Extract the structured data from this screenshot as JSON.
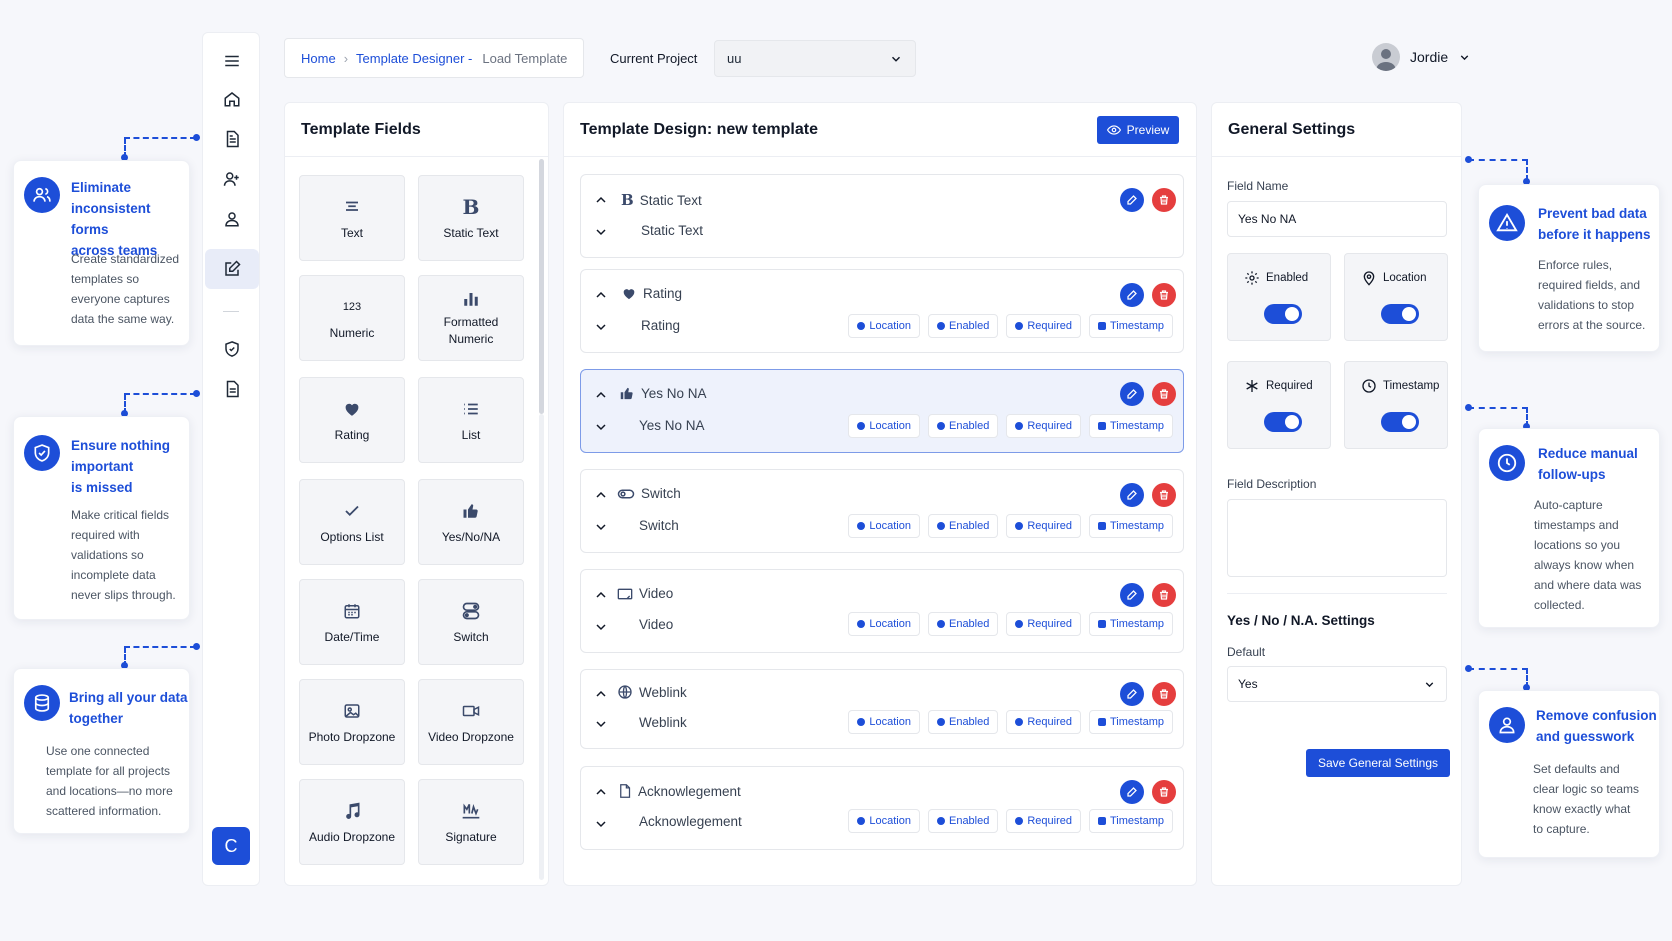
{
  "breadcrumb": {
    "home": "Home",
    "designer": "Template Designer -",
    "current": "Load Template"
  },
  "project": {
    "label": "Current Project",
    "value": "uu"
  },
  "user": {
    "name": "Jordie"
  },
  "sidebar": {
    "logo_letter": "C"
  },
  "callouts": [
    {
      "title1": "Eliminate",
      "title2": "inconsistent forms",
      "title3": "across teams",
      "lines": [
        "Create standardized",
        "templates so",
        "everyone captures",
        "data the same way."
      ]
    },
    {
      "title1": "Ensure nothing",
      "title2": "important",
      "title3": "is missed",
      "lines": [
        "Make critical fields",
        "required with",
        "validations so",
        "incomplete data",
        "never slips through."
      ]
    },
    {
      "title1": "Bring all your data",
      "title2": "together",
      "lines": [
        "Use one connected",
        "template for all projects",
        "and locations—no more",
        "scattered information."
      ]
    },
    {
      "title1": "Prevent bad data",
      "title2": "before it happens",
      "lines": [
        "Enforce rules,",
        "required fields, and",
        "validations to stop",
        "errors at the source."
      ]
    },
    {
      "title1": "Reduce manual",
      "title2": "follow-ups",
      "lines": [
        "Auto-capture",
        "timestamps and",
        "locations so you",
        "always know when",
        "and where data was",
        "collected."
      ]
    },
    {
      "title1": "Remove confusion",
      "title2": "and guesswork",
      "lines": [
        "Set defaults and",
        "clear logic so teams",
        "know exactly what",
        "to capture."
      ]
    }
  ],
  "template_fields": {
    "title": "Template Fields",
    "tiles": [
      {
        "label": "Text",
        "icon": "align-center-icon"
      },
      {
        "label": "Static Text",
        "icon": "bold-b-icon"
      },
      {
        "label": "Numeric",
        "icon": "123-icon",
        "glyph": "123"
      },
      {
        "label1": "Formatted",
        "label2": "Numeric",
        "icon": "bar-chart-icon"
      },
      {
        "label": "Rating",
        "icon": "heart-icon"
      },
      {
        "label": "List",
        "icon": "list-icon"
      },
      {
        "label": "Options List",
        "icon": "check-icon"
      },
      {
        "label": "Yes/No/NA",
        "icon": "thumbs-up-icon"
      },
      {
        "label": "Date/Time",
        "icon": "calendar-icon"
      },
      {
        "label": "Switch",
        "icon": "switch-icon"
      },
      {
        "label": "Photo Dropzone",
        "icon": "image-icon"
      },
      {
        "label": "Video Dropzone",
        "icon": "video-icon"
      },
      {
        "label": "Audio Dropzone",
        "icon": "music-icon"
      },
      {
        "label": "Signature",
        "icon": "signature-icon"
      }
    ]
  },
  "design": {
    "title": "Template Design: new template",
    "preview_label": "Preview",
    "tag_labels": {
      "location": "Location",
      "enabled": "Enabled",
      "required": "Required",
      "timestamp": "Timestamp"
    },
    "cards": [
      {
        "type": "Static Text",
        "name": "Static Text",
        "icon": "bold-b-icon"
      },
      {
        "type": "Rating",
        "name": "Rating",
        "icon": "heart-icon"
      },
      {
        "type": "Yes No NA",
        "name": "Yes No NA",
        "icon": "thumbs-up-icon"
      },
      {
        "type": "Switch",
        "name": "Switch",
        "icon": "switch-icon"
      },
      {
        "type": "Video",
        "name": "Video",
        "icon": "video-icon"
      },
      {
        "type": "Weblink",
        "name": "Weblink",
        "icon": "globe-icon"
      },
      {
        "type": "Acknowlegement",
        "name": "Acknowlegement",
        "icon": "file-icon"
      }
    ]
  },
  "settings": {
    "title": "General Settings",
    "field_name_label": "Field Name",
    "field_name_value": "Yes No NA",
    "toggles": [
      {
        "label": "Enabled",
        "on": true
      },
      {
        "label": "Location",
        "on": true
      },
      {
        "label": "Required",
        "on": true
      },
      {
        "label": "Timestamp",
        "on": true
      }
    ],
    "description_label": "Field Description",
    "description_value": "",
    "section_title": "Yes / No / N.A. Settings",
    "default_label": "Default",
    "default_value": "Yes",
    "save_label": "Save General Settings"
  },
  "colors": {
    "accent": "#1d4ed8",
    "danger": "#e53e3e",
    "selected_bg": "#eef2fc"
  }
}
